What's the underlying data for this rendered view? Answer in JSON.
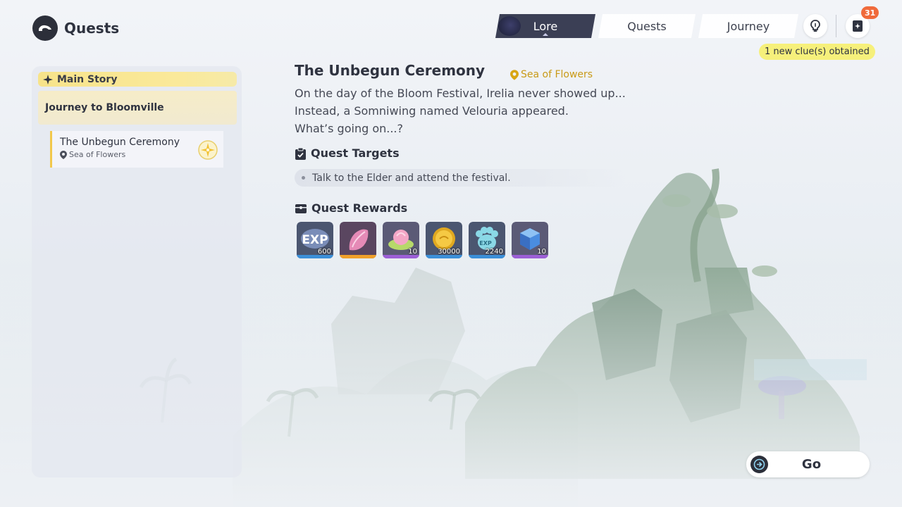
{
  "app": {
    "title": "Quests"
  },
  "tabs": [
    {
      "label": "Lore",
      "active": true
    },
    {
      "label": "Quests",
      "active": false
    },
    {
      "label": "Journey",
      "active": false
    }
  ],
  "header": {
    "hint_icon": "lightbulb-icon",
    "notes_icon": "clue-notebook-icon",
    "notes_badge": "31",
    "clue_note": "1 new clue(s) obtained"
  },
  "sidebar": {
    "section": "Main Story",
    "chapter": "Journey to Bloomville",
    "quest": {
      "title": "The Unbegun Ceremony",
      "location": "Sea of Flowers"
    }
  },
  "detail": {
    "title": "The Unbegun Ceremony",
    "location": "Sea of Flowers",
    "description": [
      "On the day of the Bloom Festival, Irelia never showed up...",
      "Instead, a Somniwing named Velouria appeared.",
      "What’s going on...?"
    ],
    "targets_heading": "Quest Targets",
    "targets": [
      "Talk to the Elder and attend the festival."
    ],
    "rewards_heading": "Quest Rewards",
    "rewards": [
      {
        "icon": "exp-icon",
        "quantity": "600",
        "rarity": "blue"
      },
      {
        "icon": "pink-crystal-icon",
        "quantity": "",
        "rarity": "orange"
      },
      {
        "icon": "flower-bud-icon",
        "quantity": "10",
        "rarity": "purple"
      },
      {
        "icon": "gold-coin-icon",
        "quantity": "30000",
        "rarity": "blue"
      },
      {
        "icon": "pet-exp-paw-icon",
        "quantity": "2240",
        "rarity": "blue"
      },
      {
        "icon": "blue-cube-icon",
        "quantity": "10",
        "rarity": "purple"
      }
    ],
    "go_label": "Go"
  },
  "colors": {
    "accent_dark": "#3b3f55",
    "highlight_yellow": "#f6f07b",
    "location_gold": "#c99a17",
    "badge_orange": "#f06a3b"
  }
}
